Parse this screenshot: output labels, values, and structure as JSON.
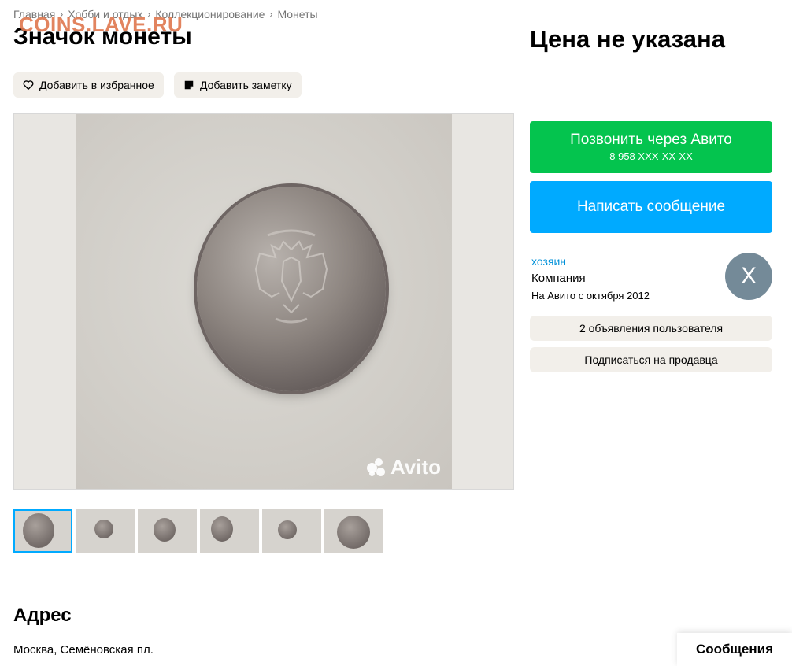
{
  "watermark": "COINS.LAVE.RU",
  "breadcrumb": [
    "Главная",
    "Хобби и отдых",
    "Коллекционирование",
    "Монеты"
  ],
  "title": "Значок монеты",
  "price": "Цена не указана",
  "actions": {
    "favorite": "Добавить в избранное",
    "note": "Добавить заметку"
  },
  "photo": {
    "watermark_text": "Avito"
  },
  "contact": {
    "call_label": "Позвонить через Авито",
    "call_phone": "8 958 XXX-XX-XX",
    "message_label": "Написать сообщение"
  },
  "seller": {
    "name": "хозяин",
    "type": "Компания",
    "since": "На Авито с октября 2012",
    "avatar_letter": "X",
    "avatar_color": "#748a98",
    "ads_button": "2 объявления пользователя",
    "subscribe_button": "Подписаться на продавца"
  },
  "address": {
    "title": "Адрес",
    "text": "Москва, Семёновская пл."
  },
  "messages_tab": "Сообщения",
  "colors": {
    "call_green": "#04c44e",
    "message_blue": "#00aaff",
    "link_blue": "#0091d9",
    "secondary_button": "#f2efea"
  }
}
